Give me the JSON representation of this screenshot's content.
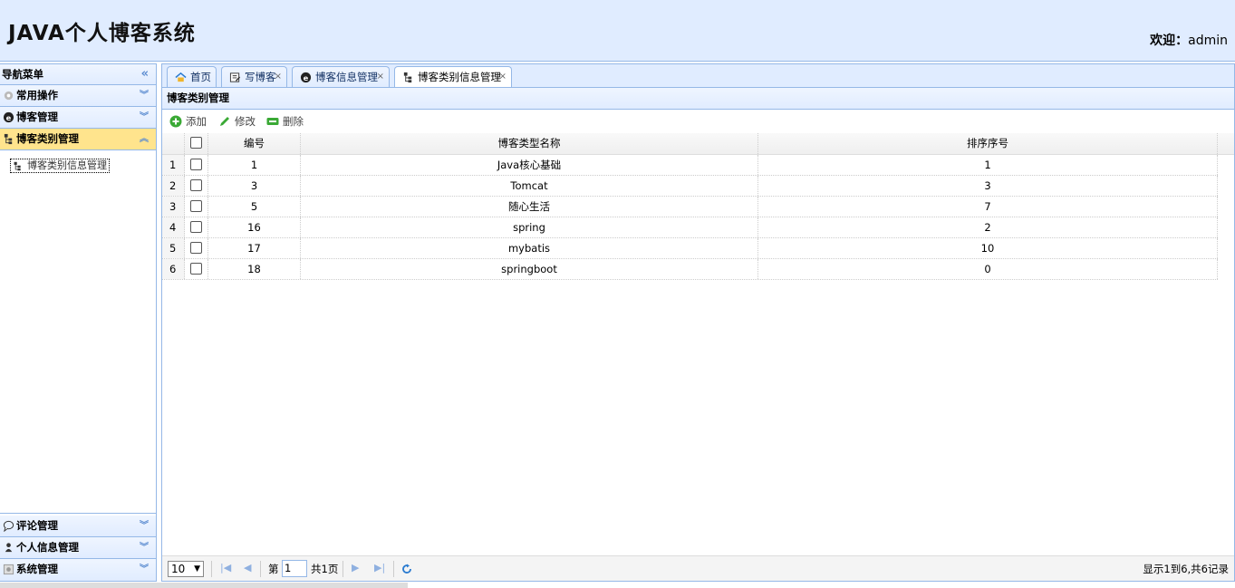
{
  "header": {
    "title": "JAVA个人博客系统",
    "welcome_label": "欢迎：",
    "username": "admin"
  },
  "sidebar": {
    "title": "导航菜单",
    "sections": [
      {
        "label": "常用操作",
        "icon": "gear-icon"
      },
      {
        "label": "博客管理",
        "icon": "blog-icon"
      },
      {
        "label": "博客类别管理",
        "icon": "tree-icon",
        "active": true
      }
    ],
    "active_items": [
      {
        "label": "博客类别信息管理",
        "icon": "tree-icon"
      }
    ],
    "bottom_sections": [
      {
        "label": "评论管理",
        "icon": "comment-icon"
      },
      {
        "label": "个人信息管理",
        "icon": "user-icon"
      },
      {
        "label": "系统管理",
        "icon": "system-icon"
      }
    ]
  },
  "tabs": [
    {
      "label": "首页",
      "icon": "home-icon",
      "closable": false
    },
    {
      "label": "写博客",
      "icon": "write-icon",
      "closable": true
    },
    {
      "label": "博客信息管理",
      "icon": "blog-icon",
      "closable": true
    },
    {
      "label": "博客类别信息管理",
      "icon": "tree-icon",
      "closable": true,
      "selected": true
    }
  ],
  "panel": {
    "title": "博客类别管理"
  },
  "toolbar": {
    "add": "添加",
    "edit": "修改",
    "delete": "删除"
  },
  "grid": {
    "columns": [
      "编号",
      "博客类型名称",
      "排序序号"
    ],
    "rows": [
      {
        "n": "1",
        "id": "1",
        "name": "Java核心基础",
        "order": "1"
      },
      {
        "n": "2",
        "id": "3",
        "name": "Tomcat",
        "order": "3"
      },
      {
        "n": "3",
        "id": "5",
        "name": "随心生活",
        "order": "7"
      },
      {
        "n": "4",
        "id": "16",
        "name": "spring",
        "order": "2"
      },
      {
        "n": "5",
        "id": "17",
        "name": "mybatis",
        "order": "10"
      },
      {
        "n": "6",
        "id": "18",
        "name": "springboot",
        "order": "0"
      }
    ]
  },
  "pager": {
    "page_size": "10",
    "page_prefix": "第",
    "page_value": "1",
    "page_total": "共1页",
    "info": "显示1到6,共6记录"
  },
  "colors": {
    "accent": "#95b8e7",
    "header_bg": "#e0ecff",
    "active_bg": "#ffe48d"
  }
}
